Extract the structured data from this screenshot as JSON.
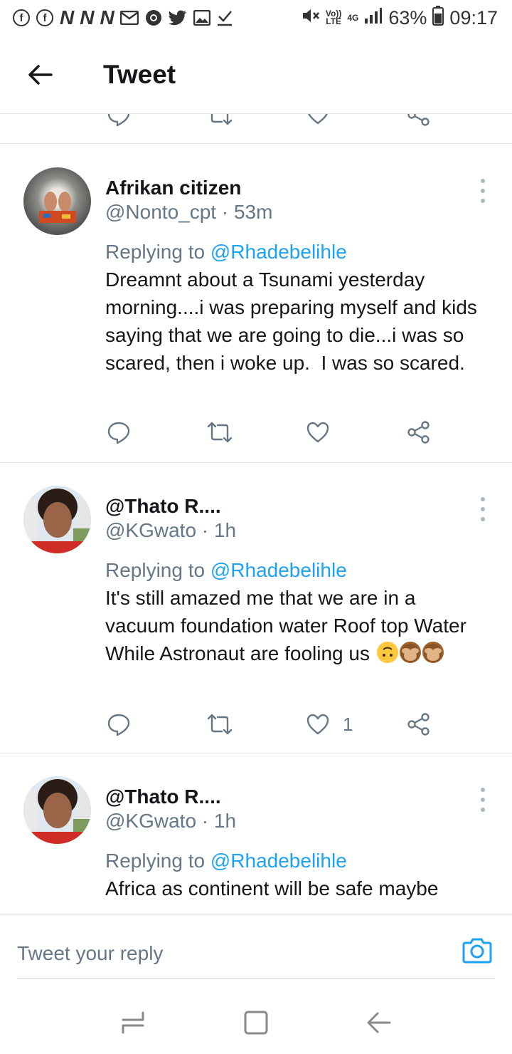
{
  "status_bar": {
    "left_icons": [
      "facebook-icon",
      "facebook-icon",
      "news-icon",
      "news-icon",
      "news-icon",
      "gmail-icon",
      "chrome-icon",
      "twitter-icon",
      "gallery-icon",
      "download-check-icon"
    ],
    "news_letter": "N",
    "volte": "Vo))\nLTE",
    "network": "4G",
    "battery": "63%",
    "time": "09:17"
  },
  "header": {
    "title": "Tweet"
  },
  "tweets": [
    {
      "name": "Afrikan citizen",
      "handle": "@Nonto_cpt · 53m",
      "replying_prefix": "Replying to ",
      "replying_to": "@Rhadebelihle",
      "text": "Dreamnt about a Tsunami yesterday morning....i was preparing myself and kids saying that we are going to die...i was so scared, then i woke up.  I was so scared.",
      "like_count": ""
    },
    {
      "name": "@Thato R....",
      "handle": "@KGwato · 1h",
      "replying_prefix": "Replying to ",
      "replying_to": "@Rhadebelihle",
      "text": "It's still amazed me that we are in a vacuum foundation water Roof top Water\nWhile Astronaut are fooling us ",
      "emojis": [
        "upside-down-face",
        "see-no-evil-monkey",
        "see-no-evil-monkey"
      ],
      "like_count": "1"
    },
    {
      "name": "@Thato R....",
      "handle": "@KGwato · 1h",
      "replying_prefix": "Replying to ",
      "replying_to": "@Rhadebelihle",
      "text": "Africa as continent will be safe maybe",
      "like_count": ""
    }
  ],
  "compose": {
    "placeholder": "Tweet your reply"
  },
  "colors": {
    "accent": "#1da1f2",
    "secondary_text": "#657786",
    "divider": "#e1e8ed"
  }
}
